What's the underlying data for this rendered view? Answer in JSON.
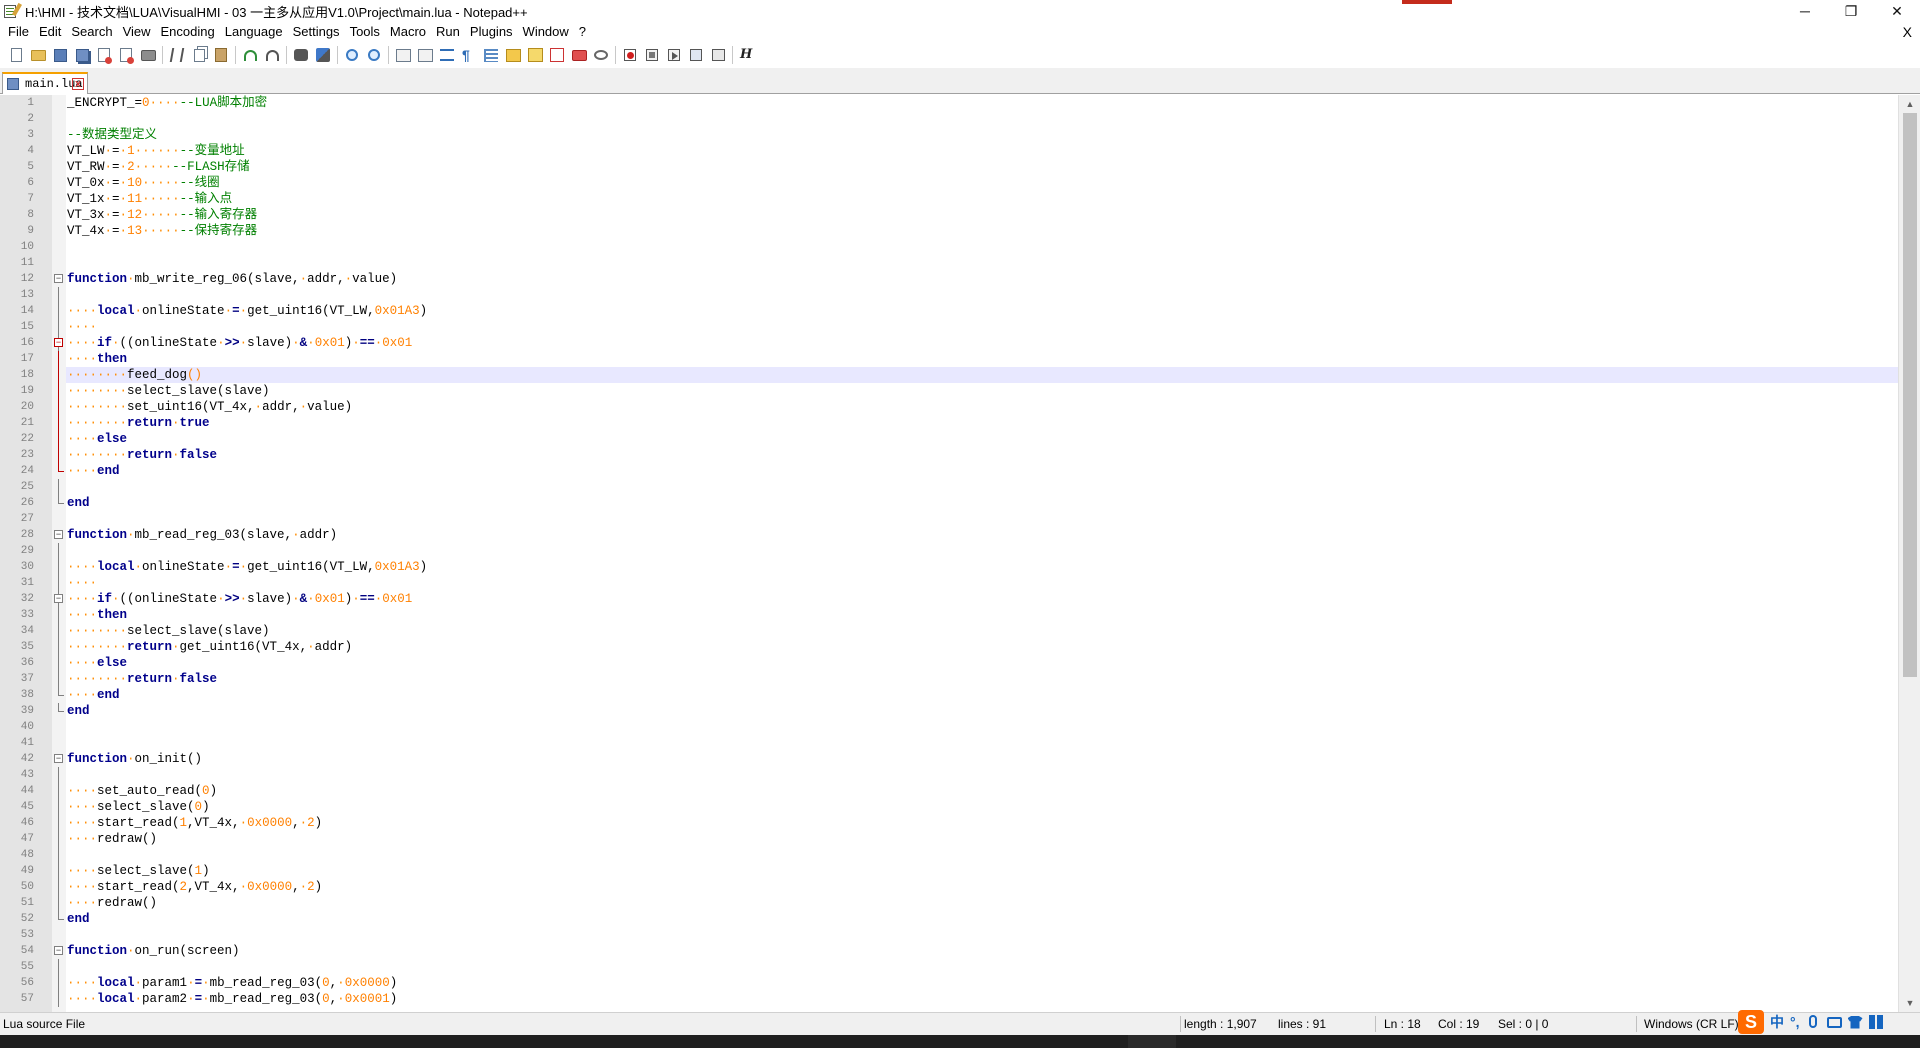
{
  "window": {
    "title": "H:\\HMI - 技术文档\\LUA\\VisualHMI - 03 一主多从应用V1.0\\Project\\main.lua - Notepad++",
    "minimize": "─",
    "restore": "❐",
    "close": "✕",
    "doc_close": "X"
  },
  "menu": [
    "File",
    "Edit",
    "Search",
    "View",
    "Encoding",
    "Language",
    "Settings",
    "Tools",
    "Macro",
    "Run",
    "Plugins",
    "Window",
    "?"
  ],
  "toolbar_icons": [
    "new-file-icon",
    "open-folder-icon",
    "save-icon",
    "save-all-icon",
    "close-icon",
    "close-all-icon",
    "print-icon",
    "|",
    "cut-icon",
    "copy-icon",
    "paste-icon",
    "|",
    "undo-icon",
    "redo-icon",
    "|",
    "find-icon",
    "replace-icon",
    "|",
    "zoom-in-icon",
    "zoom-out-icon",
    "|",
    "sync-scroll-v-icon",
    "sync-scroll-h-icon",
    "word-wrap-icon",
    "show-all-chars-icon",
    "indent-guide-icon",
    "language-icon",
    "doc-map-icon",
    "function-list-icon",
    "folder-workspace-icon",
    "monitor-icon",
    "|",
    "record-macro-icon",
    "stop-record-icon",
    "playback-macro-icon",
    "run-multiple-icon",
    "save-macro-icon",
    "|",
    "h-icon"
  ],
  "tab": {
    "label": "main.lua",
    "close": "x"
  },
  "editor": {
    "current_line": 18,
    "lines": [
      [
        [
          "_ENCRYPT_",
          "t"
        ],
        [
          "=",
          "t"
        ],
        [
          "0",
          "n"
        ],
        [
          "····",
          "w"
        ],
        [
          "--LUA脚本加密",
          "c"
        ]
      ],
      [],
      [
        [
          "--数据类型定义",
          "c"
        ]
      ],
      [
        [
          "VT_LW",
          "t"
        ],
        [
          "·",
          "w"
        ],
        [
          "=",
          "t"
        ],
        [
          "·",
          "w"
        ],
        [
          "1",
          "n"
        ],
        [
          "······",
          "w"
        ],
        [
          "--变量地址",
          "c"
        ]
      ],
      [
        [
          "VT_RW",
          "t"
        ],
        [
          "·",
          "w"
        ],
        [
          "=",
          "t"
        ],
        [
          "·",
          "w"
        ],
        [
          "2",
          "n"
        ],
        [
          "·····",
          "w"
        ],
        [
          "--FLASH存储",
          "c"
        ]
      ],
      [
        [
          "VT_0x",
          "t"
        ],
        [
          "·",
          "w"
        ],
        [
          "=",
          "t"
        ],
        [
          "·",
          "w"
        ],
        [
          "10",
          "n"
        ],
        [
          "·····",
          "w"
        ],
        [
          "--线圈",
          "c"
        ]
      ],
      [
        [
          "VT_1x",
          "t"
        ],
        [
          "·",
          "w"
        ],
        [
          "=",
          "t"
        ],
        [
          "·",
          "w"
        ],
        [
          "11",
          "n"
        ],
        [
          "·····",
          "w"
        ],
        [
          "--输入点",
          "c"
        ]
      ],
      [
        [
          "VT_3x",
          "t"
        ],
        [
          "·",
          "w"
        ],
        [
          "=",
          "t"
        ],
        [
          "·",
          "w"
        ],
        [
          "12",
          "n"
        ],
        [
          "·····",
          "w"
        ],
        [
          "--输入寄存器",
          "c"
        ]
      ],
      [
        [
          "VT_4x",
          "t"
        ],
        [
          "·",
          "w"
        ],
        [
          "=",
          "t"
        ],
        [
          "·",
          "w"
        ],
        [
          "13",
          "n"
        ],
        [
          "·····",
          "w"
        ],
        [
          "--保持寄存器",
          "c"
        ]
      ],
      [],
      [],
      [
        [
          "function",
          "k"
        ],
        [
          "·",
          "w"
        ],
        [
          "mb_write_reg_06(slave,",
          "t"
        ],
        [
          "·",
          "w"
        ],
        [
          "addr,",
          "t"
        ],
        [
          "·",
          "w"
        ],
        [
          "value)",
          "t"
        ]
      ],
      [],
      [
        [
          "····",
          "w"
        ],
        [
          "local",
          "k"
        ],
        [
          "·",
          "w"
        ],
        [
          "onlineState",
          "t"
        ],
        [
          "·",
          "w"
        ],
        [
          "=",
          "o"
        ],
        [
          "·",
          "w"
        ],
        [
          "get_uint16(VT_LW,",
          "t"
        ],
        [
          "0x01A3",
          "n"
        ],
        [
          ")",
          "t"
        ]
      ],
      [
        [
          "····",
          "w"
        ]
      ],
      [
        [
          "····",
          "w"
        ],
        [
          "if",
          "k"
        ],
        [
          "·",
          "w"
        ],
        [
          "((onlineState",
          "t"
        ],
        [
          "·",
          "w"
        ],
        [
          ">>",
          "o"
        ],
        [
          "·",
          "w"
        ],
        [
          "slave)",
          "t"
        ],
        [
          "·",
          "w"
        ],
        [
          "&",
          "o"
        ],
        [
          "·",
          "w"
        ],
        [
          "0x01",
          "n"
        ],
        [
          ")",
          "t"
        ],
        [
          "·",
          "w"
        ],
        [
          "==",
          "o"
        ],
        [
          "·",
          "w"
        ],
        [
          "0x01",
          "n"
        ]
      ],
      [
        [
          "····",
          "w"
        ],
        [
          "then",
          "k"
        ]
      ],
      [
        [
          "········",
          "w"
        ],
        [
          "feed_dog",
          "t"
        ],
        [
          "()",
          "n"
        ]
      ],
      [
        [
          "········",
          "w"
        ],
        [
          "select_slave(slave)",
          "t"
        ]
      ],
      [
        [
          "········",
          "w"
        ],
        [
          "set_uint16(VT_4x,",
          "t"
        ],
        [
          "·",
          "w"
        ],
        [
          "addr,",
          "t"
        ],
        [
          "·",
          "w"
        ],
        [
          "value)",
          "t"
        ]
      ],
      [
        [
          "········",
          "w"
        ],
        [
          "return",
          "k"
        ],
        [
          "·",
          "w"
        ],
        [
          "true",
          "k"
        ]
      ],
      [
        [
          "····",
          "w"
        ],
        [
          "else",
          "k"
        ]
      ],
      [
        [
          "········",
          "w"
        ],
        [
          "return",
          "k"
        ],
        [
          "·",
          "w"
        ],
        [
          "false",
          "k"
        ]
      ],
      [
        [
          "····",
          "w"
        ],
        [
          "end",
          "k"
        ]
      ],
      [],
      [
        [
          "end",
          "k"
        ]
      ],
      [],
      [
        [
          "function",
          "k"
        ],
        [
          "·",
          "w"
        ],
        [
          "mb_read_reg_03(slave,",
          "t"
        ],
        [
          "·",
          "w"
        ],
        [
          "addr)",
          "t"
        ]
      ],
      [],
      [
        [
          "····",
          "w"
        ],
        [
          "local",
          "k"
        ],
        [
          "·",
          "w"
        ],
        [
          "onlineState",
          "t"
        ],
        [
          "·",
          "w"
        ],
        [
          "=",
          "o"
        ],
        [
          "·",
          "w"
        ],
        [
          "get_uint16(VT_LW,",
          "t"
        ],
        [
          "0x01A3",
          "n"
        ],
        [
          ")",
          "t"
        ]
      ],
      [
        [
          "····",
          "w"
        ]
      ],
      [
        [
          "····",
          "w"
        ],
        [
          "if",
          "k"
        ],
        [
          "·",
          "w"
        ],
        [
          "((onlineState",
          "t"
        ],
        [
          "·",
          "w"
        ],
        [
          ">>",
          "o"
        ],
        [
          "·",
          "w"
        ],
        [
          "slave)",
          "t"
        ],
        [
          "·",
          "w"
        ],
        [
          "&",
          "o"
        ],
        [
          "·",
          "w"
        ],
        [
          "0x01",
          "n"
        ],
        [
          ")",
          "t"
        ],
        [
          "·",
          "w"
        ],
        [
          "==",
          "o"
        ],
        [
          "·",
          "w"
        ],
        [
          "0x01",
          "n"
        ]
      ],
      [
        [
          "····",
          "w"
        ],
        [
          "then",
          "k"
        ]
      ],
      [
        [
          "········",
          "w"
        ],
        [
          "select_slave(slave)",
          "t"
        ]
      ],
      [
        [
          "········",
          "w"
        ],
        [
          "return",
          "k"
        ],
        [
          "·",
          "w"
        ],
        [
          "get_uint16(VT_4x,",
          "t"
        ],
        [
          "·",
          "w"
        ],
        [
          "addr)",
          "t"
        ]
      ],
      [
        [
          "····",
          "w"
        ],
        [
          "else",
          "k"
        ]
      ],
      [
        [
          "········",
          "w"
        ],
        [
          "return",
          "k"
        ],
        [
          "·",
          "w"
        ],
        [
          "false",
          "k"
        ]
      ],
      [
        [
          "····",
          "w"
        ],
        [
          "end",
          "k"
        ]
      ],
      [
        [
          "end",
          "k"
        ]
      ],
      [],
      [],
      [
        [
          "function",
          "k"
        ],
        [
          "·",
          "w"
        ],
        [
          "on_init()",
          "t"
        ]
      ],
      [],
      [
        [
          "····",
          "w"
        ],
        [
          "set_auto_read(",
          "t"
        ],
        [
          "0",
          "n"
        ],
        [
          ")",
          "t"
        ]
      ],
      [
        [
          "····",
          "w"
        ],
        [
          "select_slave(",
          "t"
        ],
        [
          "0",
          "n"
        ],
        [
          ")",
          "t"
        ]
      ],
      [
        [
          "····",
          "w"
        ],
        [
          "start_read(",
          "t"
        ],
        [
          "1",
          "n"
        ],
        [
          ",VT_4x,",
          "t"
        ],
        [
          "·",
          "w"
        ],
        [
          "0x0000",
          "n"
        ],
        [
          ",",
          "t"
        ],
        [
          "·",
          "w"
        ],
        [
          "2",
          "n"
        ],
        [
          ")",
          "t"
        ]
      ],
      [
        [
          "····",
          "w"
        ],
        [
          "redraw()",
          "t"
        ]
      ],
      [],
      [
        [
          "····",
          "w"
        ],
        [
          "select_slave(",
          "t"
        ],
        [
          "1",
          "n"
        ],
        [
          ")",
          "t"
        ]
      ],
      [
        [
          "····",
          "w"
        ],
        [
          "start_read(",
          "t"
        ],
        [
          "2",
          "n"
        ],
        [
          ",VT_4x,",
          "t"
        ],
        [
          "·",
          "w"
        ],
        [
          "0x0000",
          "n"
        ],
        [
          ",",
          "t"
        ],
        [
          "·",
          "w"
        ],
        [
          "2",
          "n"
        ],
        [
          ")",
          "t"
        ]
      ],
      [
        [
          "····",
          "w"
        ],
        [
          "redraw()",
          "t"
        ]
      ],
      [
        [
          "end",
          "k"
        ]
      ],
      [],
      [
        [
          "function",
          "k"
        ],
        [
          "·",
          "w"
        ],
        [
          "on_run(screen)",
          "t"
        ]
      ],
      [],
      [
        [
          "····",
          "w"
        ],
        [
          "local",
          "k"
        ],
        [
          "·",
          "w"
        ],
        [
          "param1",
          "t"
        ],
        [
          "·",
          "w"
        ],
        [
          "=",
          "o"
        ],
        [
          "·",
          "w"
        ],
        [
          "mb_read_reg_03(",
          "t"
        ],
        [
          "0",
          "n"
        ],
        [
          ",",
          "t"
        ],
        [
          "·",
          "w"
        ],
        [
          "0x0000",
          "n"
        ],
        [
          ")",
          "t"
        ]
      ],
      [
        [
          "····",
          "w"
        ],
        [
          "local",
          "k"
        ],
        [
          "·",
          "w"
        ],
        [
          "param2",
          "t"
        ],
        [
          "·",
          "w"
        ],
        [
          "=",
          "o"
        ],
        [
          "·",
          "w"
        ],
        [
          "mb_read_reg_03(",
          "t"
        ],
        [
          "0",
          "n"
        ],
        [
          ",",
          "t"
        ],
        [
          "·",
          "w"
        ],
        [
          "0x0001",
          "n"
        ],
        [
          ")",
          "t"
        ]
      ]
    ]
  },
  "status": {
    "file_type": "Lua source File",
    "length": "length : 1,907",
    "lines": "lines : 91",
    "ln": "Ln : 18",
    "col": "Col : 19",
    "sel": "Sel : 0 | 0",
    "eol": "Windows (CR LF)"
  },
  "ime": {
    "logo": "S",
    "lang": "中",
    "punct": "°,"
  }
}
